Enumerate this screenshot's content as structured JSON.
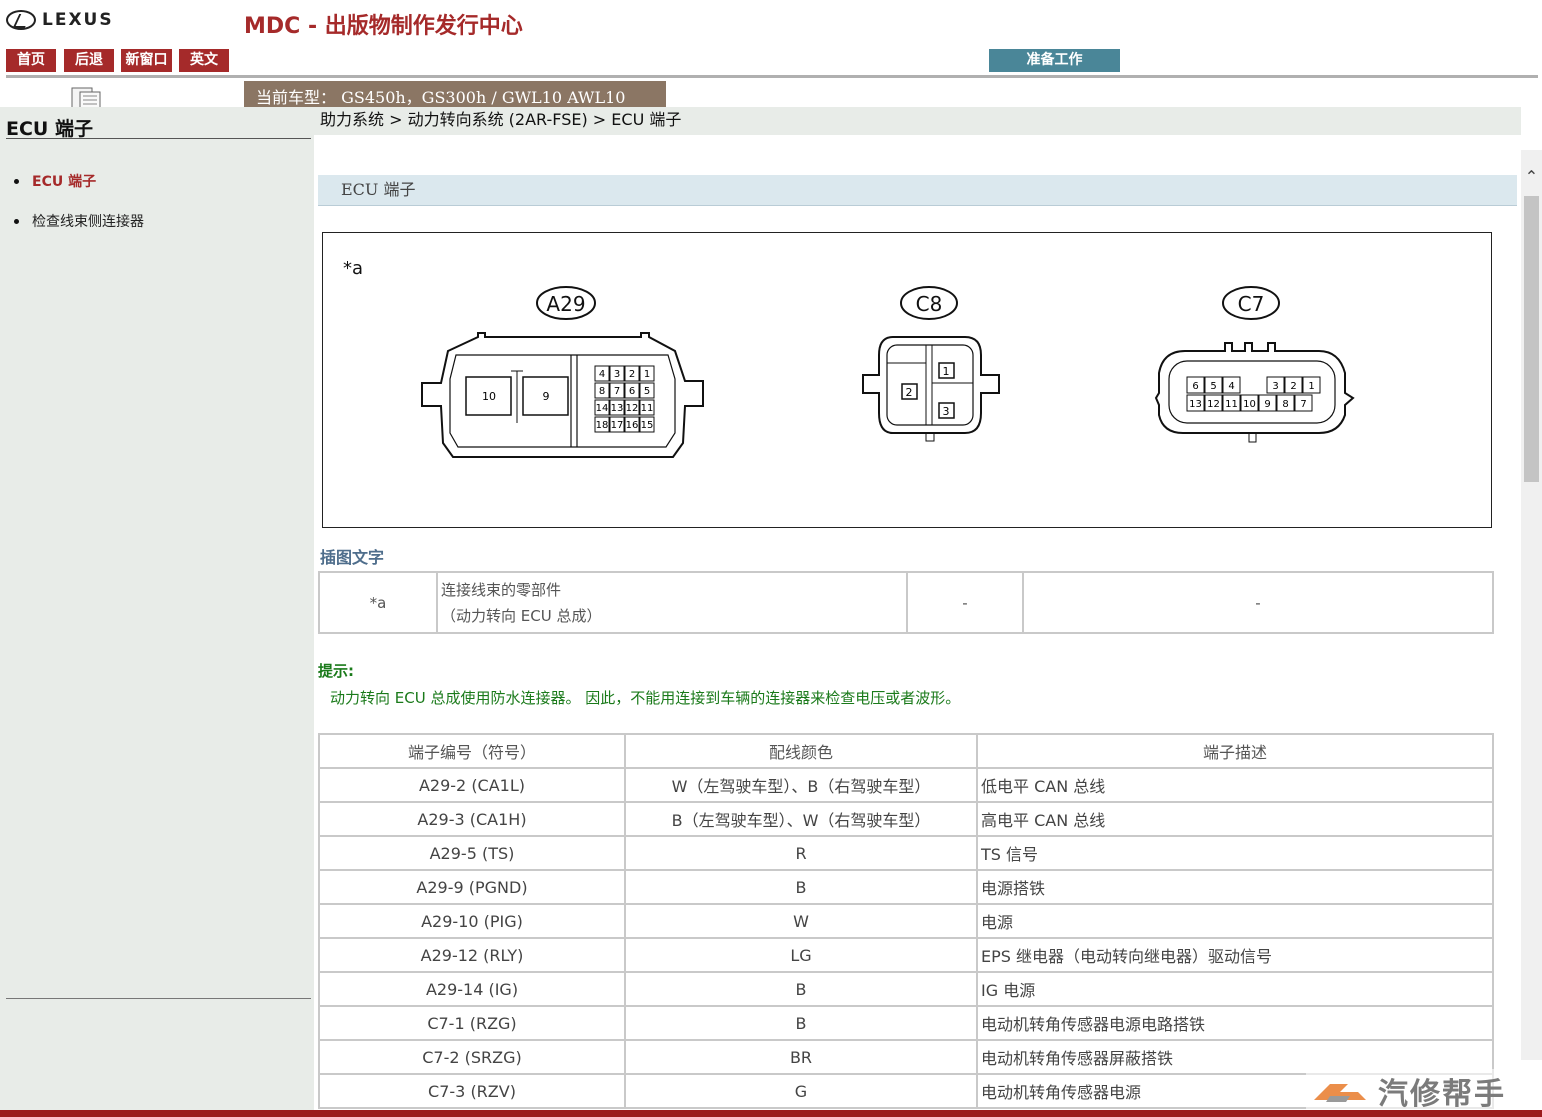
{
  "header": {
    "logo_text": "LEXUS",
    "site_title": "MDC - 出版物制作发行中心",
    "nav": [
      "首页",
      "后退",
      "新窗口",
      "英文"
    ],
    "prep_label": "准备工作",
    "vehicle_label": "当前车型：  GS450h，GS300h / GWL10 AWL10"
  },
  "sidebar": {
    "title": "ECU 端子",
    "items": [
      {
        "label": "ECU 端子",
        "active": true
      },
      {
        "label": "检查线束侧连接器",
        "active": false
      }
    ]
  },
  "breadcrumb": "助力系统 > 动力转向系统 (2AR-FSE) > ECU 端子",
  "section_title": "ECU 端子",
  "figure": {
    "callout": "*a",
    "connectors": [
      {
        "id": "A29",
        "pins": [
          "10",
          "9",
          "4",
          "3",
          "2",
          "1",
          "8",
          "7",
          "6",
          "5",
          "14",
          "13",
          "12",
          "11",
          "18",
          "17",
          "16",
          "15"
        ]
      },
      {
        "id": "C8",
        "pins": [
          "1",
          "2",
          "3"
        ]
      },
      {
        "id": "C7",
        "pins": [
          "6",
          "5",
          "4",
          "3",
          "2",
          "1",
          "13",
          "12",
          "11",
          "10",
          "9",
          "8",
          "7"
        ]
      }
    ]
  },
  "caption": {
    "label": "插图文字",
    "row": {
      "key": "*a",
      "text_line1": "连接线束的零部件",
      "text_line2": "（动力转向 ECU 总成）",
      "col3": "-",
      "col4": "-"
    }
  },
  "hint": {
    "label": "提示:",
    "text": "动力转向 ECU 总成使用防水连接器。 因此，不能用连接到车辆的连接器来检查电压或者波形。"
  },
  "pin_table": {
    "headers": [
      "端子编号（符号）",
      "配线颜色",
      "端子描述"
    ],
    "rows": [
      [
        "A29-2 (CA1L)",
        "W（左驾驶车型）、B（右驾驶车型）",
        "低电平 CAN 总线"
      ],
      [
        "A29-3 (CA1H)",
        "B（左驾驶车型）、W（右驾驶车型）",
        "高电平 CAN 总线"
      ],
      [
        "A29-5 (TS)",
        "R",
        "TS 信号"
      ],
      [
        "A29-9 (PGND)",
        "B",
        "电源搭铁"
      ],
      [
        "A29-10 (PIG)",
        "W",
        "电源"
      ],
      [
        "A29-12 (RLY)",
        "LG",
        "EPS 继电器（电动转向继电器）驱动信号"
      ],
      [
        "A29-14 (IG)",
        "B",
        "IG 电源"
      ],
      [
        "C7-1 (RZG)",
        "B",
        "电动机转角传感器电源电路搭铁"
      ],
      [
        "C7-2 (SRZG)",
        "BR",
        "电动机转角传感器屏蔽搭铁"
      ],
      [
        "C7-3 (RZV)",
        "G",
        "电动机转角传感器电源"
      ]
    ]
  },
  "watermark": "汽修帮手",
  "colors": {
    "brand_red": "#a52a2a",
    "prep_teal": "#4a8698",
    "vehicle_brown": "#8b7664",
    "hint_green": "#1a7a1a"
  }
}
